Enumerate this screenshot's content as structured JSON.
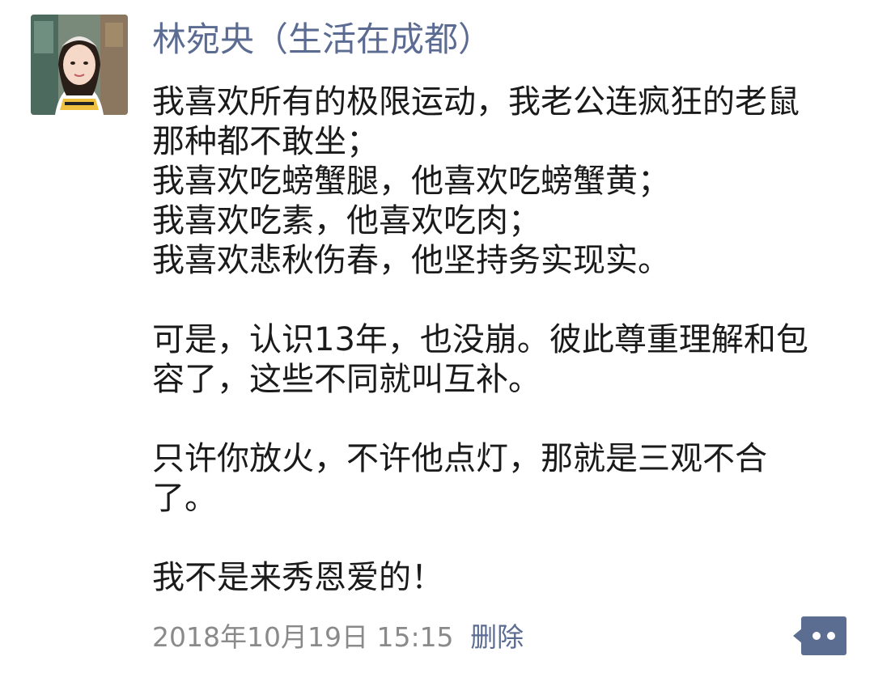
{
  "post": {
    "author": "林宛央（生活在成都）",
    "paragraphs": [
      {
        "lines": [
          "我喜欢所有的极限运动，我老公连疯狂的老鼠",
          "那种都不敢坐；",
          "我喜欢吃螃蟹腿，他喜欢吃螃蟹黄；",
          "我喜欢吃素，他喜欢吃肉；",
          "我喜欢悲秋伤春，他坚持务实现实。"
        ]
      },
      {
        "lines": [
          "可是，认识13年，也没崩。彼此尊重理解和包",
          "容了，这些不同就叫互补。"
        ]
      },
      {
        "lines": [
          "只许你放火，不许他点灯，那就是三观不合",
          "了。"
        ]
      },
      {
        "lines": [
          "我不是来秀恩爱的！"
        ]
      }
    ],
    "timestamp": "2018年10月19日 15:15",
    "delete_label": "删除"
  },
  "icons": {
    "avatar": "user-avatar-photo",
    "more": "more-dots-icon"
  },
  "colors": {
    "author_name": "#5b6b92",
    "body_text": "#1a1a1a",
    "timestamp": "#8a8a8a",
    "link": "#5b6b92",
    "more_button_bg": "#5c6d92"
  }
}
